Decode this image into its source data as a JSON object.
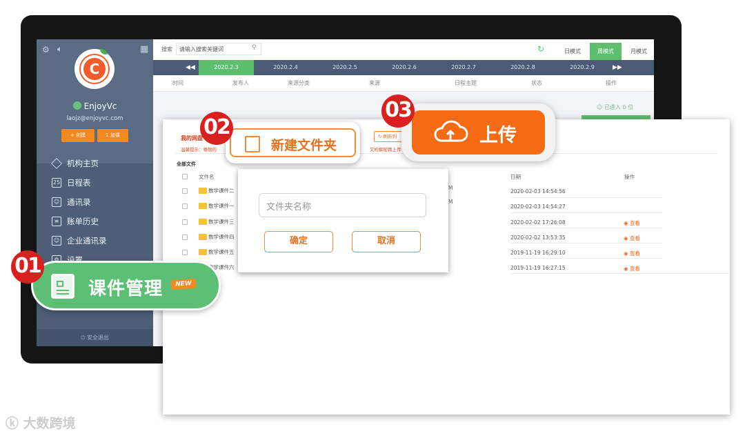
{
  "sidebar": {
    "username": "EnjoyVc",
    "email": "laojz@enjoyvc.com",
    "create_btn": "+ 创建",
    "join_btn": "1 加课",
    "menu": [
      {
        "label": "机构主页",
        "icon": "diamond-icon"
      },
      {
        "label": "日程表",
        "icon": "calendar-icon"
      },
      {
        "label": "通讯录",
        "icon": "contacts-icon"
      },
      {
        "label": "账单历史",
        "icon": "bill-icon"
      },
      {
        "label": "企业通讯录",
        "icon": "enterprise-contacts-icon"
      },
      {
        "label": "设置",
        "icon": "settings-icon"
      }
    ],
    "logout": "安全退出",
    "logo_letter": "C"
  },
  "topbar": {
    "search_label": "搜索",
    "search_placeholder": "请输入搜索关键词",
    "modes": [
      "日模式",
      "周模式",
      "月模式"
    ],
    "active_mode": "周模式"
  },
  "datebar": {
    "dates": [
      "2020.2.3",
      "2020.2.4",
      "2020.2.5",
      "2020.2.6",
      "2020.2.7",
      "2020.2.8",
      "2020.2.9"
    ],
    "active": "2020.2.3"
  },
  "columns": [
    "时间",
    "发布人",
    "来源分类",
    "来源",
    "日程主题",
    "状态",
    "操作"
  ],
  "joined": "已进入 0 位",
  "drive": {
    "title": "我的网盘",
    "tip": "温馨提示：尊敬的",
    "tip_right": "又检解密再上传",
    "refresh": "刷新列",
    "all_files": "全部文件",
    "headers": {
      "name": "文件名",
      "date": "日期",
      "action": "操作"
    },
    "files": [
      {
        "name": "数学课件二",
        "size": "M",
        "date": "2020-02-03 14:54:56",
        "action": ""
      },
      {
        "name": "数学课件一",
        "size": "M",
        "date": "2020-02-03 14:54:27",
        "action": ""
      },
      {
        "name": "数学课件三",
        "size": "",
        "date": "2020-02-02 17:26:08",
        "action": "查看"
      },
      {
        "name": "数学课件四",
        "size": "",
        "date": "2020-02-02 13:53:35",
        "action": "查看"
      },
      {
        "name": "数学课件五",
        "size": "",
        "date": "2019-11-19 16:29:10",
        "action": "查看"
      },
      {
        "name": "数学课件六",
        "size": "",
        "date": "2019-11-19 16:27:15",
        "action": "查看"
      }
    ]
  },
  "dialog": {
    "placeholder": "文件夹名称",
    "confirm": "确定",
    "cancel": "取消"
  },
  "callouts": {
    "c1": {
      "num": "01",
      "label": "课件管理",
      "badge": "NEW"
    },
    "c2": {
      "num": "02",
      "label": "新建文件夹"
    },
    "c3": {
      "num": "03",
      "label": "上传"
    }
  },
  "watermark": "大数跨境",
  "colors": {
    "accent_green": "#5dbf6e",
    "accent_orange": "#f56a14",
    "badge_red": "#d9201e",
    "sidebar": "#4d5e76"
  }
}
